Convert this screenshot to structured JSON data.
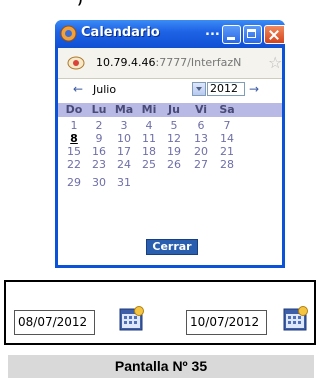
{
  "window": {
    "title": "Calendario",
    "title_ellipsis": "...",
    "address_ip": "10.79.4.46",
    "address_rest": ":7777/InterfazN"
  },
  "calendar": {
    "prev_arrow": "←",
    "next_arrow": "→",
    "month": "Julio",
    "year": "2012",
    "weekdays": [
      "Do",
      "Lu",
      "Ma",
      "Mi",
      "Ju",
      "Vi",
      "Sa"
    ],
    "weeks": [
      [
        "1",
        "2",
        "3",
        "4",
        "5",
        "6",
        "7"
      ],
      [
        "8",
        "9",
        "10",
        "11",
        "12",
        "13",
        "14"
      ],
      [
        "15",
        "16",
        "17",
        "18",
        "19",
        "20",
        "21"
      ],
      [
        "22",
        "23",
        "24",
        "25",
        "26",
        "27",
        "28"
      ],
      [
        "29",
        "30",
        "31",
        "",
        "",
        "",
        ""
      ]
    ],
    "selected_day": "8",
    "close_label": "Cerrar"
  },
  "date_fields": {
    "start_value": "08/07/2012",
    "end_value": "10/07/2012"
  },
  "caption": "Pantalla Nº 35",
  "colors": {
    "titlebar": "#0f4fd3",
    "weekday_bar": "#b9b9e6",
    "day_text": "#6f6fa8",
    "close_button": "#2a5fb0"
  }
}
